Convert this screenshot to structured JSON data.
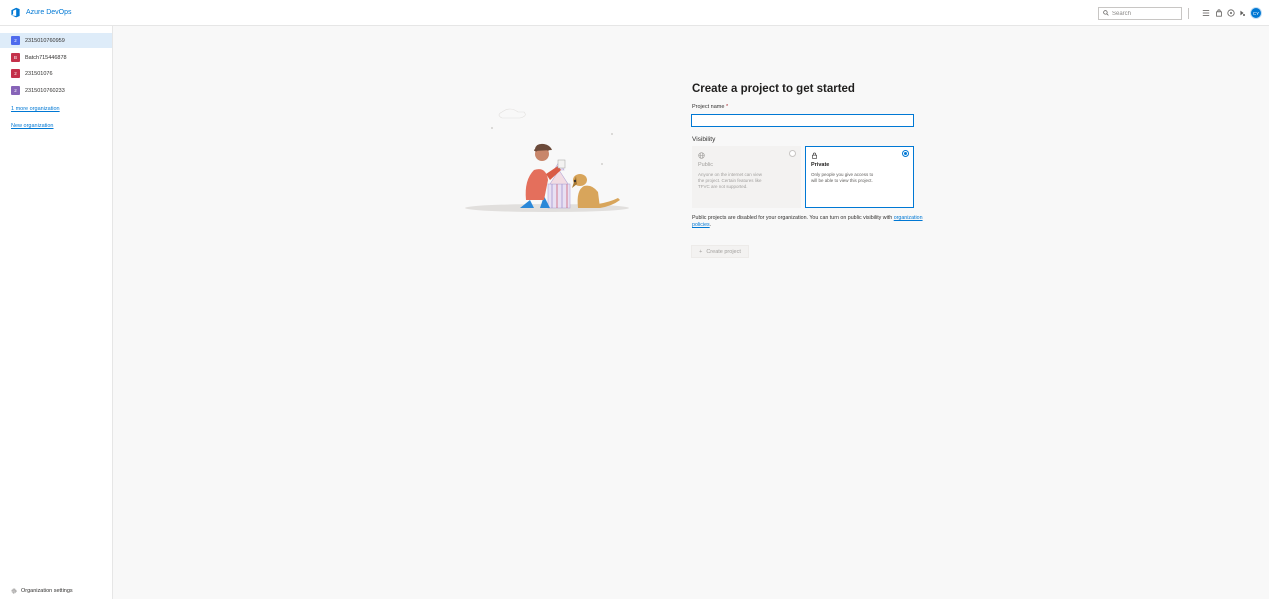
{
  "header": {
    "brand": "Azure DevOps",
    "search_placeholder": "Search",
    "avatar_initials": "CY",
    "accent_color": "#0078d4",
    "icons": [
      "list-icon",
      "shopping-bag-icon",
      "help-icon",
      "settings-icon"
    ]
  },
  "sidebar": {
    "organizations": [
      {
        "name": "2315010760959",
        "initial": "2",
        "color": "#4f6bed",
        "selected": true
      },
      {
        "name": "Batch715446878",
        "initial": "B",
        "color": "#c4314b",
        "selected": false
      },
      {
        "name": "231501076",
        "initial": "2",
        "color": "#c4314b",
        "selected": false
      },
      {
        "name": "2315010760233",
        "initial": "2",
        "color": "#8764b8",
        "selected": false
      }
    ],
    "more_orgs": "1 more organization",
    "new_org": "New organization",
    "org_settings": "Organization settings"
  },
  "main": {
    "title": "Create a project to get started",
    "project_name_label": "Project name",
    "required_mark": "*",
    "visibility_label": "Visibility",
    "public": {
      "title": "Public",
      "description": "Anyone on the internet can view the project. Certain features like TFVC are not supported.",
      "selected": false
    },
    "private": {
      "title": "Private",
      "description": "Only people you give access to will be able to view this project.",
      "selected": true
    },
    "public_note": "Public projects are disabled for your organization. You can turn on public visibility with",
    "policies_link": "organization policies",
    "policies_suffix": ".",
    "create_button": "Create project"
  }
}
